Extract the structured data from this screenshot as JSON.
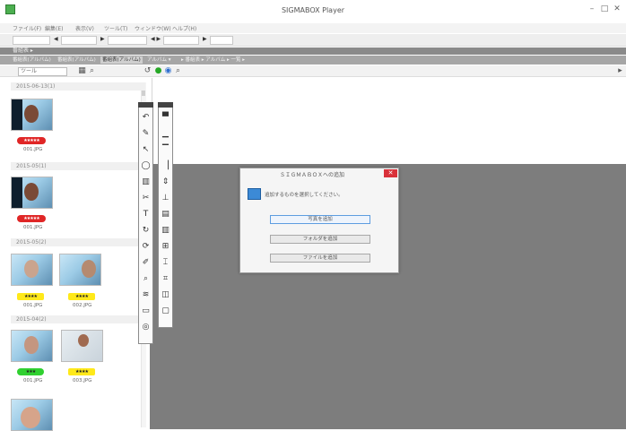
{
  "window": {
    "title": "SIGMABOX Player",
    "minimize": "–",
    "maximize": "□",
    "close": "✕"
  },
  "menu": [
    "ファイル(F)",
    "編集(E)",
    "表示(V)",
    "ツール(T)",
    "ウィンドウ(W)",
    "ヘルプ(H)"
  ],
  "toolbar": {
    "fields": [
      "",
      "",
      "",
      "",
      "",
      ""
    ],
    "arrows": [
      "◀",
      "▶",
      "▶",
      "◀ ▶",
      "▶"
    ]
  },
  "breadcrumb": "番組表 ▸ ",
  "tabs": [
    {
      "label": "番組表(アルバム)",
      "active": false
    },
    {
      "label": "番組表(アルバム)",
      "active": false
    },
    {
      "label": "番組表(アルバム)",
      "active": true
    },
    {
      "label": "アルバム ▾",
      "active": false
    },
    {
      "label": "▸ 番組表 ▸ アルバム ▸ 一覧 ▸ ",
      "active": false
    }
  ],
  "subtoolbar": {
    "search_value": "ツール",
    "icons": [
      "grid-icon",
      "zoom-icon",
      "rotate-icon",
      "green-circle-icon",
      "color-circle-icon",
      "magnify-icon"
    ]
  },
  "colors": {
    "badge_red": "#e02626",
    "badge_yellow": "#ffe91a",
    "badge_green": "#30d030",
    "dialog_close": "#d9313a",
    "dialog_icon": "#3c8ad6",
    "workspace_gray": "#7d7d7d"
  },
  "groups": [
    {
      "header": "2015-06-13(1)"
    },
    {
      "header": "2015-05(1)"
    },
    {
      "header": "2015-05(2)"
    },
    {
      "header": "2015-04(2)"
    }
  ],
  "photos": [
    {
      "rating": "★★★★★",
      "color": "red",
      "file": "001.JPG"
    },
    {
      "rating": "★★★★★",
      "color": "red",
      "file": "001.JPG"
    },
    {
      "rating": "★★★★",
      "color": "yellow",
      "file": "001.JPG"
    },
    {
      "rating": "★★★★",
      "color": "yellow",
      "file": "002.JPG"
    },
    {
      "rating": "★★★",
      "color": "green",
      "file": "001.JPG"
    },
    {
      "rating": "★★★★",
      "color": "yellow",
      "file": "003.JPG"
    }
  ],
  "palette_left": [
    "↶",
    "✎",
    "↖",
    "◯",
    "▥",
    "✂",
    "T",
    "↻",
    "⟳",
    "✐",
    "⌕",
    "≋",
    "▭",
    "◎"
  ],
  "palette_right": [
    "▀",
    "▁",
    "▔",
    "▕",
    "⇕",
    "⊥",
    "▤",
    "▥",
    "⊞",
    "⌶",
    "⌗",
    "◫",
    "▢"
  ],
  "dialog": {
    "title": "ＳＩＧＭＡＢＯＸへの追加",
    "message": "追加するものを選択してください。",
    "close": "✕",
    "buttons": [
      "写真を追加",
      "フォルダを追加",
      "ファイルを追加"
    ]
  }
}
